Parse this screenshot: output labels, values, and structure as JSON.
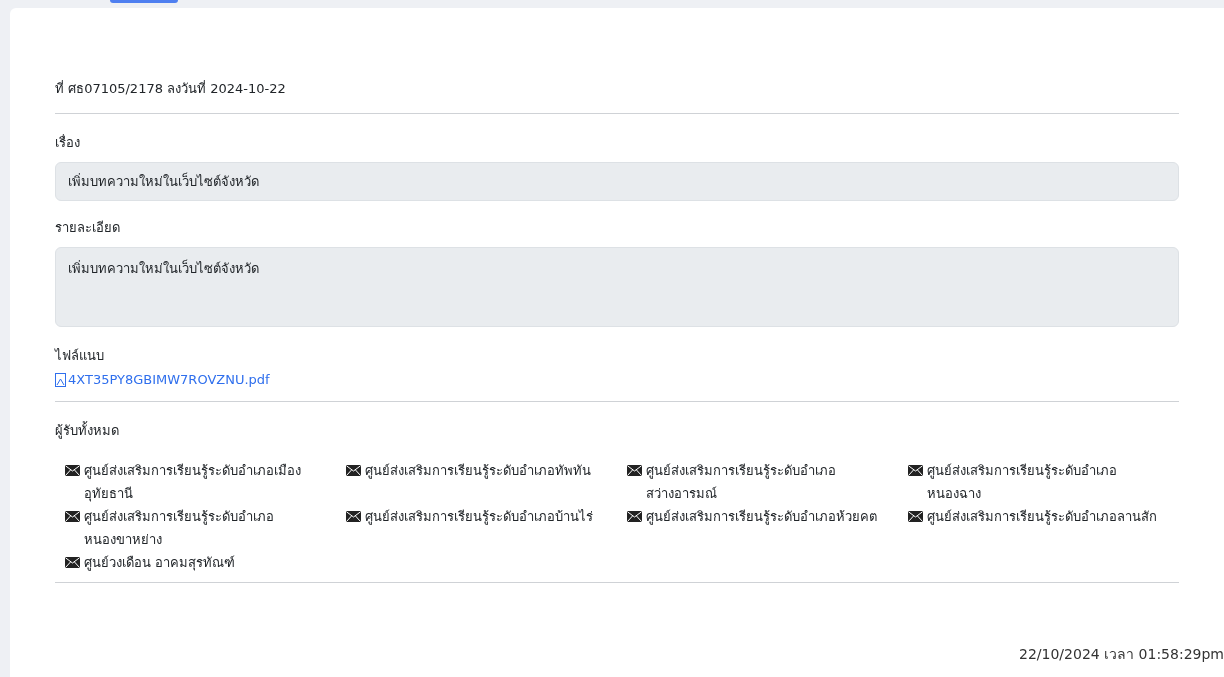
{
  "reference": "ที่ ศธ07105/2178 ลงวันที่ 2024-10-22",
  "subject": {
    "label": "เรื่อง",
    "value": "เพิ่มบทความใหม่ในเว็บไซต์จังหวัด"
  },
  "details": {
    "label": "รายละเอียด",
    "value": "เพิ่มบทความใหม่ในเว็บไซต์จังหวัด"
  },
  "attachment": {
    "label": "ไฟล์แนบ",
    "file": "4XT35PY8GBIMW7ROVZNU.pdf"
  },
  "recipients": {
    "label": "ผู้รับทั้งหมด",
    "items": [
      "ศูนย์ส่งเสริมการเรียนรู้ระดับอำเภอเมืองอุทัยธานี",
      "ศูนย์ส่งเสริมการเรียนรู้ระดับอำเภอทัพทัน",
      "ศูนย์ส่งเสริมการเรียนรู้ระดับอำเภอสว่างอารมณ์",
      "ศูนย์ส่งเสริมการเรียนรู้ระดับอำเภอหนองฉาง",
      "ศูนย์ส่งเสริมการเรียนรู้ระดับอำเภอหนองขาหย่าง",
      "ศูนย์ส่งเสริมการเรียนรู้ระดับอำเภอบ้านไร่",
      "ศูนย์ส่งเสริมการเรียนรู้ระดับอำเภอห้วยคต",
      "ศูนย์ส่งเสริมการเรียนรู้ระดับอำเภอลานสัก",
      "ศูนย์วงเดือน อาคมสุรทัณฑ์"
    ]
  },
  "timestamp": "22/10/2024 เวลา 01:58:29pm"
}
